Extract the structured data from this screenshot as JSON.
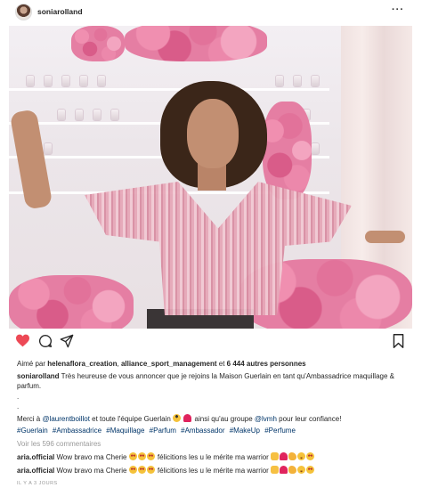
{
  "post": {
    "username": "soniarolland",
    "more_label": "···"
  },
  "actions": {
    "like_icon": "heart-filled-icon",
    "comment_icon": "comment-icon",
    "share_icon": "share-icon",
    "save_icon": "bookmark-icon"
  },
  "likes": {
    "prefix": "Aimé par ",
    "user1": "helenaflora_creation",
    "sep": ", ",
    "user2": "alliance_sport_management",
    "mid": " et ",
    "count_text": "6 444 autres personnes"
  },
  "caption": {
    "author": "soniarolland",
    "text": " Très heureuse de vous annoncer que je rejoins la Maison Guerlain en tant qu'Ambassadrice maquillage & parfum.",
    "dot1": ".",
    "dot2": ".",
    "merci_start": "Merci à ",
    "mention1": "@laurentboillot",
    "merci_mid": " et toute l'équipe Guerlain ",
    "merci_mid2": " ainsi qu'au groupe ",
    "mention2": "@lvmh",
    "merci_end": " pour leur confiance!",
    "hashtags": [
      "#Guerlain",
      "#Ambassadrice",
      "#Maquillage",
      "#Parfum",
      "#Ambassador",
      "#MakeUp",
      "#Perfume"
    ]
  },
  "view_all": "Voir les 596 commentaires",
  "comments": [
    {
      "user": "aria.official",
      "text": " Wow bravo ma Cherie ",
      "text2": " félicitions les u le mérite ma warrior "
    },
    {
      "user": "aria.official",
      "text": " Wow bravo ma Cherie ",
      "text2": " félicitions les u le mérite ma warrior "
    }
  ],
  "timestamp": "IL Y A 3 JOURS",
  "colors": {
    "like_red": "#ed4956",
    "link_blue": "#003569",
    "muted": "#999999"
  }
}
